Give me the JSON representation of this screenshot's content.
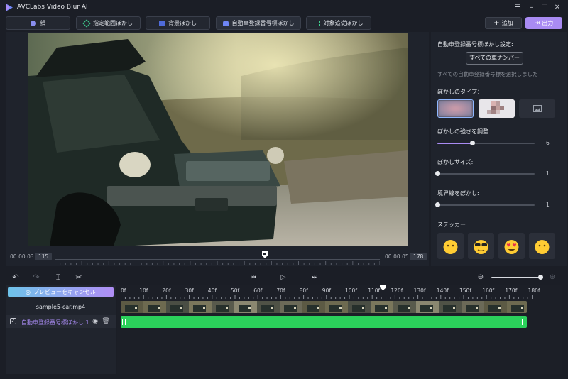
{
  "app": {
    "title": "AVCLabs Video Blur AI"
  },
  "window": {
    "menu_icon": "hamburger-icon",
    "minimize_icon": "minimize-icon",
    "maximize_icon": "maximize-icon",
    "close_icon": "close-icon"
  },
  "modes": [
    {
      "label": "顔",
      "icon": "face-icon"
    },
    {
      "label": "指定範囲ぼかし",
      "icon": "region-icon"
    },
    {
      "label": "背景ぼかし",
      "icon": "background-icon"
    },
    {
      "label": "自動車登録番号標ぼかし",
      "icon": "car-icon"
    },
    {
      "label": "対象追従ぼかし",
      "icon": "target-icon"
    }
  ],
  "actions": {
    "add_label": "追加",
    "export_label": "出力"
  },
  "preview": {
    "start_time": "00:00:03",
    "start_frame": "115",
    "end_time": "00:00:05",
    "end_frame": "178"
  },
  "settings": {
    "heading": "自動車登録番号標ぼかし設定:",
    "all_plates_button": "すべての車ナンバー",
    "all_plates_status": "すべての自動車登録番号標を選択しました",
    "blur_type_label": "ぼかしのタイプ：",
    "strength_label": "ぼかしの強さを調整:",
    "strength_value": "6",
    "strength_fraction": 0.36,
    "size_label": "ぼかしサイズ:",
    "size_value": "1",
    "border_label": "境界線をぼかし:",
    "border_value": "1",
    "sticker_label": "ステッカー:",
    "stickers": [
      "😶",
      "😎",
      "😍",
      "😶"
    ]
  },
  "timeline": {
    "cancel_preview_label": "プレビューをキャンセル",
    "clip_name": "sample5-car.mp4",
    "track_label": "自動車登録番号標ぼかし 1",
    "ticks": [
      "0f",
      "10f",
      "20f",
      "30f",
      "40f",
      "50f",
      "60f",
      "70f",
      "80f",
      "90f",
      "100f",
      "110f",
      "120f",
      "130f",
      "140f",
      "150f",
      "160f",
      "170f",
      "180f"
    ],
    "zoom_fraction": 0.97
  },
  "colors": {
    "accent": "#a98bf3",
    "track": "#2bd15b",
    "background": "#1b1e26"
  }
}
